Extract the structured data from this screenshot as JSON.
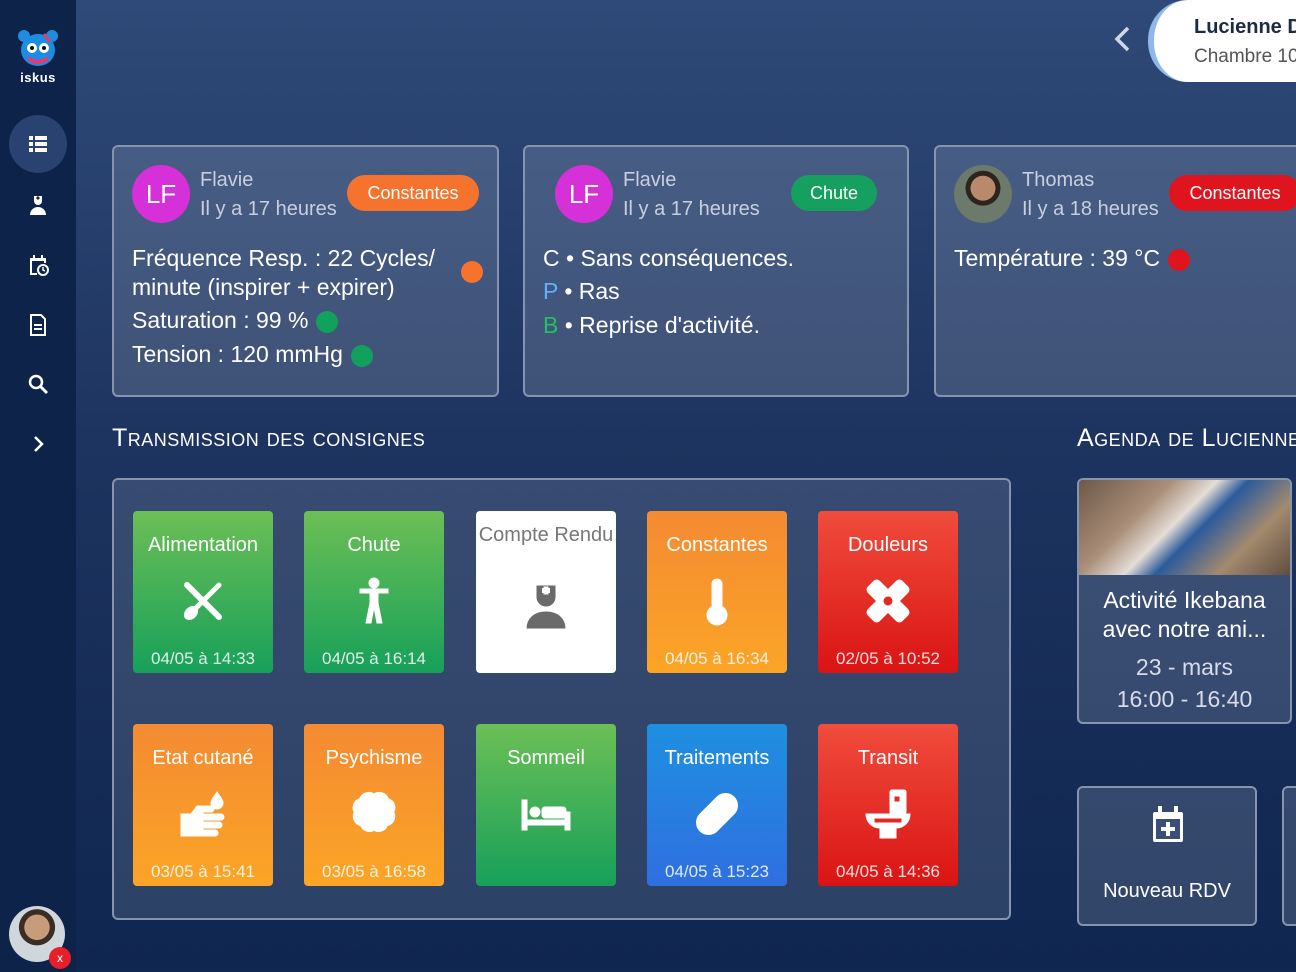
{
  "app": {
    "logo_text": "iskus"
  },
  "patient": {
    "name": "Lucienne D",
    "room": "Chambre 10"
  },
  "cards": [
    {
      "initials": "LF",
      "author": "Flavie",
      "time": "Il y a 17 heures",
      "tag": "Constantes",
      "tag_color": "#f5732d",
      "lines": [
        {
          "text": "Fréquence Resp. : 22 Cycles/",
          "status_color": "#f5732d"
        },
        {
          "text": "minute (inspirer + expirer)"
        },
        {
          "text": "Saturation : 99 %",
          "status_color": "#12a15c"
        },
        {
          "text": "Tension : 120 mmHg",
          "status_color": "#12a15c"
        }
      ]
    },
    {
      "initials": "LF",
      "author": "Flavie",
      "time": "Il y a 17 heures",
      "tag": "Chute",
      "tag_color": "#15a060",
      "cpb": [
        {
          "letter": "C",
          "letter_color": "#ffffff",
          "text": "• Sans conséquences."
        },
        {
          "letter": "P",
          "letter_color": "#5eb1ff",
          "text": "• Ras"
        },
        {
          "letter": "B",
          "letter_color": "#21c163",
          "text": "• Reprise d'activité."
        }
      ]
    },
    {
      "author": "Thomas",
      "time": "Il y a 18 heures",
      "tag": "Constantes",
      "tag_color": "#e0141e",
      "lines": [
        {
          "text": "Température : 39 °C",
          "status_color": "#e0141e"
        }
      ]
    }
  ],
  "consignes": {
    "title": "Transmission des consignes",
    "tiles": [
      {
        "label": "Alimentation",
        "date": "04/05 à 14:33",
        "icon": "utensils-icon"
      },
      {
        "label": "Chute",
        "date": "04/05 à 16:14",
        "icon": "person-standing-icon"
      },
      {
        "label": "Compte Rendu",
        "date": "",
        "icon": "nurse-icon"
      },
      {
        "label": "Constantes",
        "date": "04/05 à 16:34",
        "icon": "thermometer-icon"
      },
      {
        "label": "Douleurs",
        "date": "02/05 à 10:52",
        "icon": "bandage-icon"
      },
      {
        "label": "Etat cutané",
        "date": "03/05 à 15:41",
        "icon": "hand-wash-icon"
      },
      {
        "label": "Psychisme",
        "date": "03/05 à 16:58",
        "icon": "brain-icon"
      },
      {
        "label": "Sommeil",
        "date": "",
        "icon": "bed-icon"
      },
      {
        "label": "Traitements",
        "date": "04/05 à 15:23",
        "icon": "pill-icon"
      },
      {
        "label": "Transit",
        "date": "04/05 à 14:36",
        "icon": "toilet-icon"
      }
    ]
  },
  "agenda": {
    "title": "Agenda de Lucienne",
    "event_title": "Activité Ikebana avec notre ani...",
    "event_date": "23 - mars",
    "event_hours": "16:00 - 16:40",
    "new_rdv_label": "Nouveau RDV"
  },
  "user": {
    "badge": "x"
  }
}
